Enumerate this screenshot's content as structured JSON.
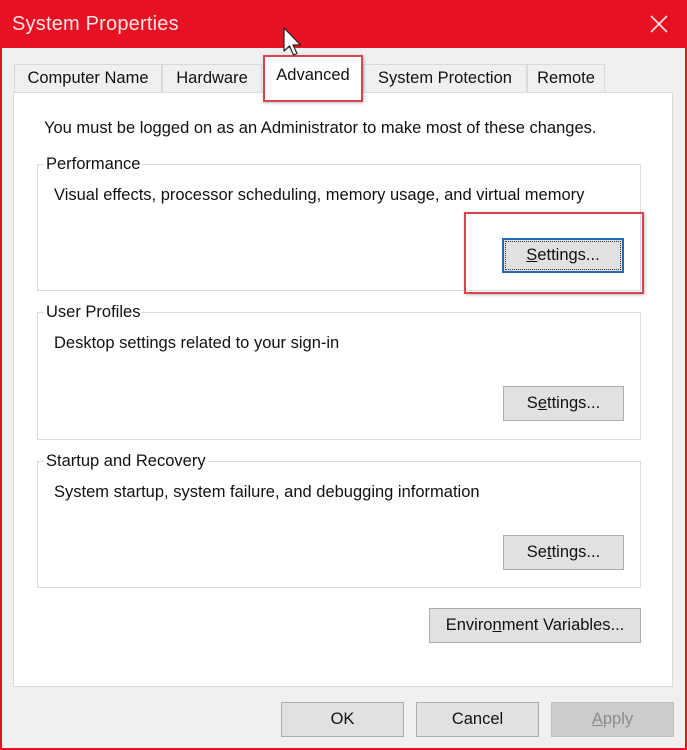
{
  "window": {
    "title": "System Properties",
    "close_icon": "close-icon",
    "titlebar_color": "#e81123"
  },
  "tabs": [
    {
      "label": "Computer Name",
      "active": false
    },
    {
      "label": "Hardware",
      "active": false
    },
    {
      "label": "Advanced",
      "active": true
    },
    {
      "label": "System Protection",
      "active": false
    },
    {
      "label": "Remote",
      "active": false
    }
  ],
  "advanced": {
    "admin_note": "You must be logged on as an Administrator to make most of these changes.",
    "performance": {
      "label": "Performance",
      "description": "Visual effects, processor scheduling, memory usage, and virtual memory",
      "button": {
        "label_prefix": "",
        "accel": "S",
        "label_suffix": "ettings..."
      }
    },
    "user_profiles": {
      "label": "User Profiles",
      "description": "Desktop settings related to your sign-in",
      "button": {
        "label_prefix": "S",
        "accel": "e",
        "label_suffix": "ttings..."
      }
    },
    "startup_recovery": {
      "label": "Startup and Recovery",
      "description": "System startup, system failure, and debugging information",
      "button": {
        "label_prefix": "Se",
        "accel": "t",
        "label_suffix": "tings..."
      }
    },
    "env_button": {
      "label_prefix": "Enviro",
      "accel": "n",
      "label_suffix": "ment Variables..."
    }
  },
  "footer": {
    "ok": "OK",
    "cancel": "Cancel",
    "apply": {
      "accel": "A",
      "label_suffix": "pply"
    }
  },
  "annotations": {
    "highlight_color": "#d9444c"
  },
  "cursor_icon": "mouse-pointer-icon"
}
